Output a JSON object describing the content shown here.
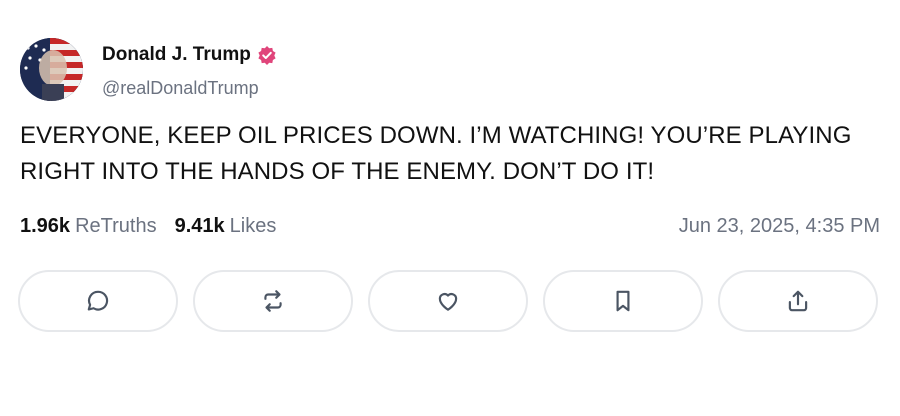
{
  "author": {
    "name": "Donald J. Trump",
    "handle": "@realDonaldTrump",
    "verified_badge_color": "#e0457b"
  },
  "post": {
    "text": "EVERYONE, KEEP OIL PRICES DOWN. I’M WATCHING! YOU’RE PLAYING RIGHT INTO THE HANDS OF THE ENEMY. DON’T DO IT!"
  },
  "stats": {
    "retruths_count": "1.96k",
    "retruths_label": "ReTruths",
    "likes_count": "9.41k",
    "likes_label": "Likes"
  },
  "timestamp": "Jun 23, 2025, 4:35 PM",
  "actions": [
    {
      "icon": "comment-icon"
    },
    {
      "icon": "retruth-icon"
    },
    {
      "icon": "heart-icon"
    },
    {
      "icon": "bookmark-icon"
    },
    {
      "icon": "share-icon"
    }
  ]
}
